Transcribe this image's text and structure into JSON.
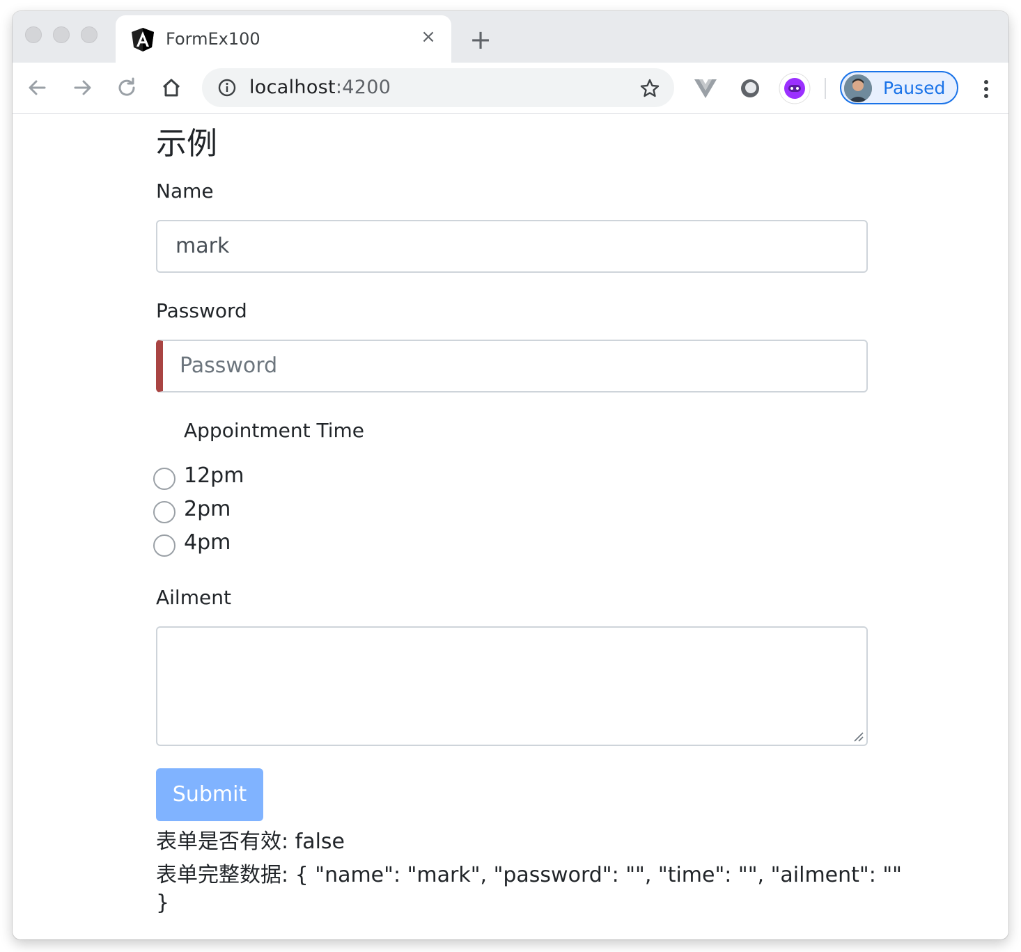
{
  "browser": {
    "tab": {
      "title": "FormEx100",
      "close_label": "×"
    },
    "new_tab_label": "+",
    "address": {
      "host": "localhost",
      "port": ":4200"
    },
    "profile": {
      "label": "Paused"
    },
    "colors": {
      "accent": "#1a73e8",
      "tabstrip": "#e8eaed"
    }
  },
  "page": {
    "heading": "示例",
    "name": {
      "label": "Name",
      "value": "mark"
    },
    "password": {
      "label": "Password",
      "placeholder": "Password",
      "value": ""
    },
    "appointment": {
      "label": "Appointment Time",
      "options": [
        {
          "label": "12pm",
          "selected": false
        },
        {
          "label": "2pm",
          "selected": false
        },
        {
          "label": "4pm",
          "selected": false
        }
      ]
    },
    "ailment": {
      "label": "Ailment",
      "value": ""
    },
    "submit_label": "Submit",
    "status": {
      "valid_line": "表单是否有效: false",
      "data_line_1": "表单完整数据: { \"name\": \"mark\", \"password\": \"\", \"time\": \"\", \"ailment\": \"\"",
      "data_line_2": "}"
    },
    "colors": {
      "invalid_border": "#a94442",
      "submit_disabled": "#80b3ff"
    }
  }
}
